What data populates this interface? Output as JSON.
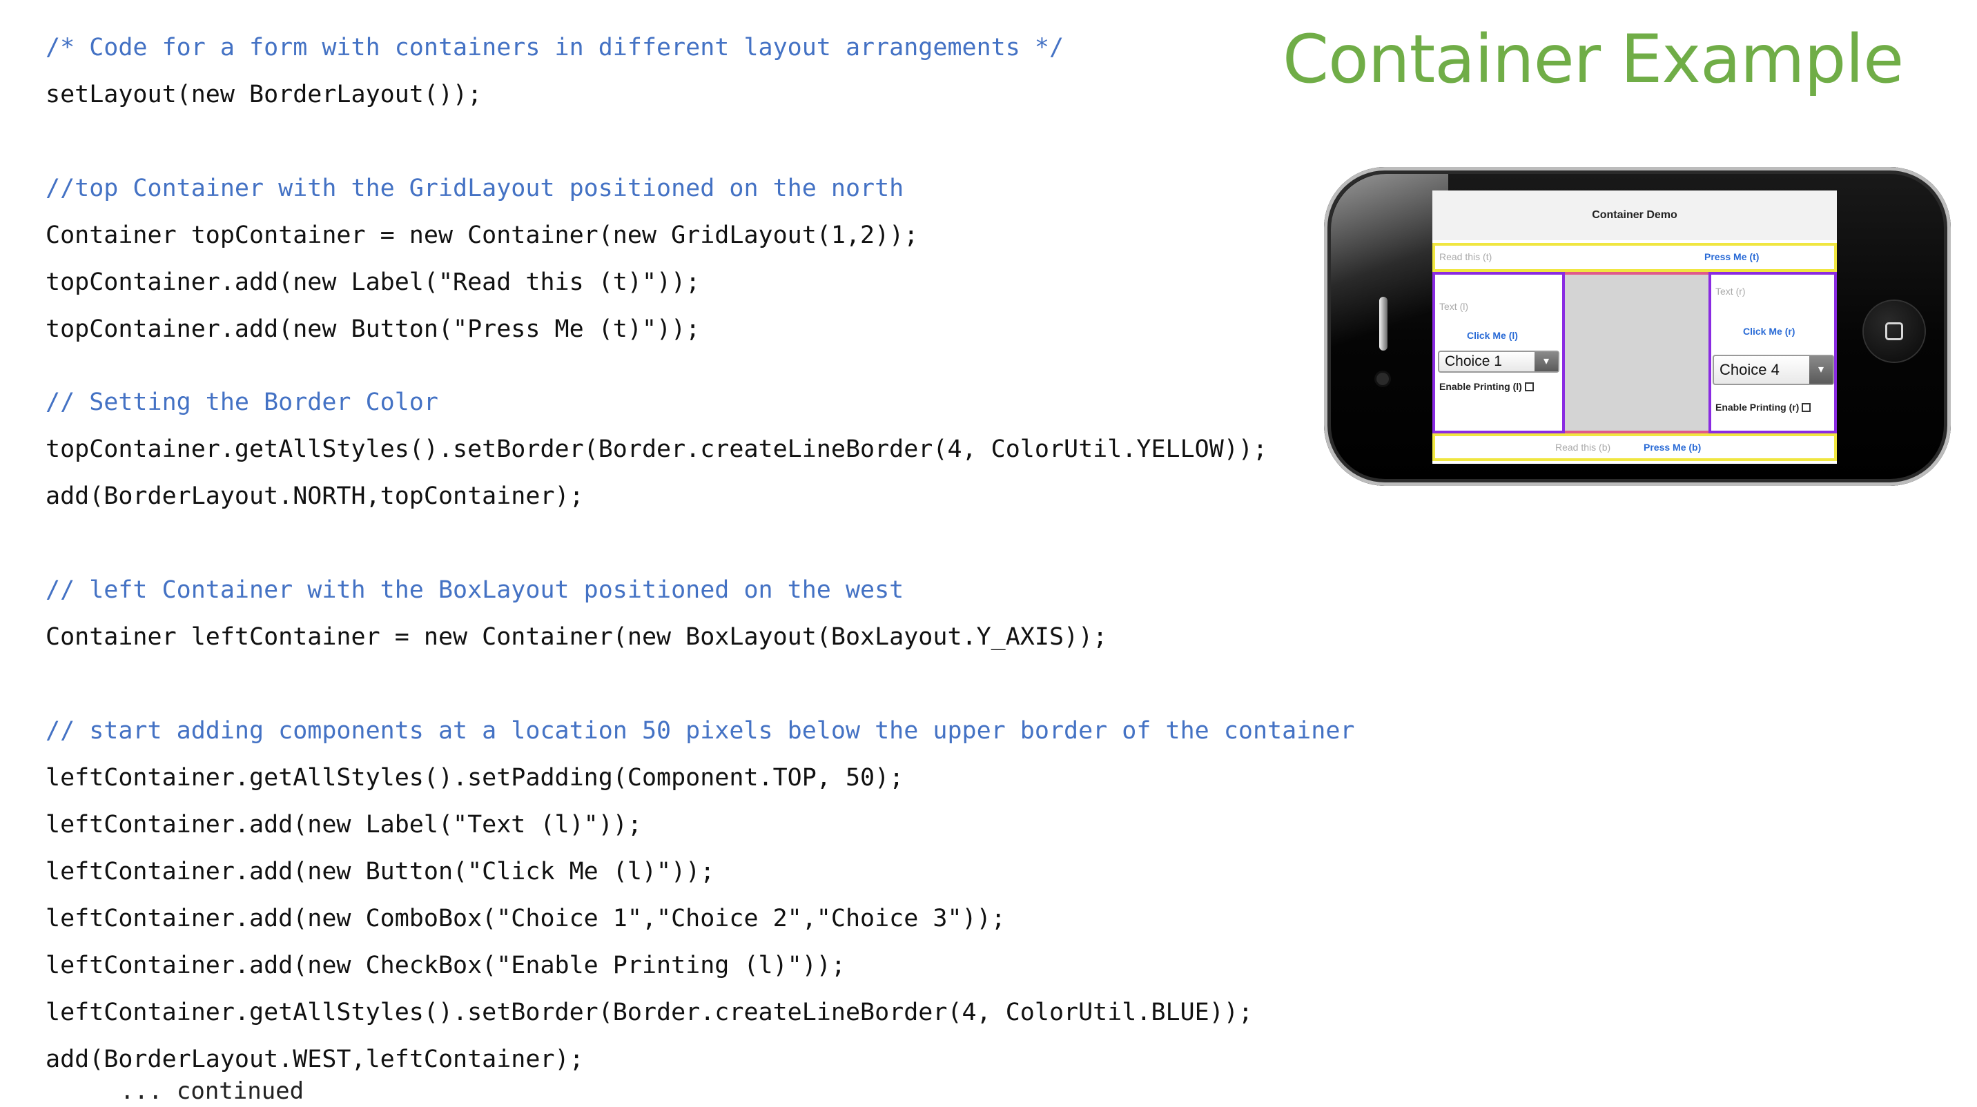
{
  "slide": {
    "title": "Container Example",
    "title_color": "#70ad47",
    "code_color": "#111111",
    "comment_color": "#4472c4"
  },
  "code": {
    "lines": [
      {
        "text": "/* Code for a form with containers in different layout arrangements */",
        "kind": "comment"
      },
      {
        "text": "setLayout(new BorderLayout());",
        "kind": "code"
      },
      {
        "text": "//top Container with the GridLayout positioned on the north",
        "kind": "comment"
      },
      {
        "text": "Container topContainer = new Container(new GridLayout(1,2));",
        "kind": "code"
      },
      {
        "text": "topContainer.add(new Label(\"Read this (t)\"));",
        "kind": "code"
      },
      {
        "text": "topContainer.add(new Button(\"Press Me (t)\"));",
        "kind": "code"
      },
      {
        "text": "// Setting the Border Color",
        "kind": "comment"
      },
      {
        "text": "topContainer.getAllStyles().setBorder(Border.createLineBorder(4, ColorUtil.YELLOW));",
        "kind": "code"
      },
      {
        "text": "add(BorderLayout.NORTH,topContainer);",
        "kind": "code"
      },
      {
        "text": "// left Container with the BoxLayout positioned on the west",
        "kind": "comment"
      },
      {
        "text": "Container leftContainer = new Container(new BoxLayout(BoxLayout.Y_AXIS));",
        "kind": "code"
      },
      {
        "text": "// start adding components at a location 50 pixels below the upper border of the container",
        "kind": "comment"
      },
      {
        "text": "leftContainer.getAllStyles().setPadding(Component.TOP, 50);",
        "kind": "code"
      },
      {
        "text": "leftContainer.add(new Label(\"Text (l)\"));",
        "kind": "code"
      },
      {
        "text": "leftContainer.add(new Button(\"Click Me (l)\"));",
        "kind": "code"
      },
      {
        "text": "leftContainer.add(new ComboBox(\"Choice 1\",\"Choice 2\",\"Choice 3\"));",
        "kind": "code"
      },
      {
        "text": "leftContainer.add(new CheckBox(\"Enable Printing (l)\"));",
        "kind": "code"
      },
      {
        "text": "leftContainer.getAllStyles().setBorder(Border.createLineBorder(4, ColorUtil.BLUE));",
        "kind": "code"
      },
      {
        "text": "add(BorderLayout.WEST,leftContainer);",
        "kind": "code"
      },
      {
        "text": "... continued",
        "kind": "continued"
      }
    ]
  },
  "phone": {
    "form_title": "Container Demo",
    "north": {
      "label": "Read this (t)",
      "button": "Press Me (t)"
    },
    "west": {
      "label": "Text (l)",
      "button": "Click Me (l)",
      "combo_value": "Choice 1",
      "checkbox": "Enable Printing (l)"
    },
    "east": {
      "label": "Text (r)",
      "button": "Click Me (r)",
      "combo_value": "Choice 4",
      "checkbox": "Enable Printing (r)"
    },
    "south": {
      "label": "Read this (b)",
      "button": "Press Me (b)"
    },
    "combo_arrow": "▾",
    "colors": {
      "north_south_border": "#f0e640",
      "west_east_border": "#8a2be2",
      "center_fill": "#d4d4d4",
      "button_text": "#2a6bd6"
    }
  }
}
